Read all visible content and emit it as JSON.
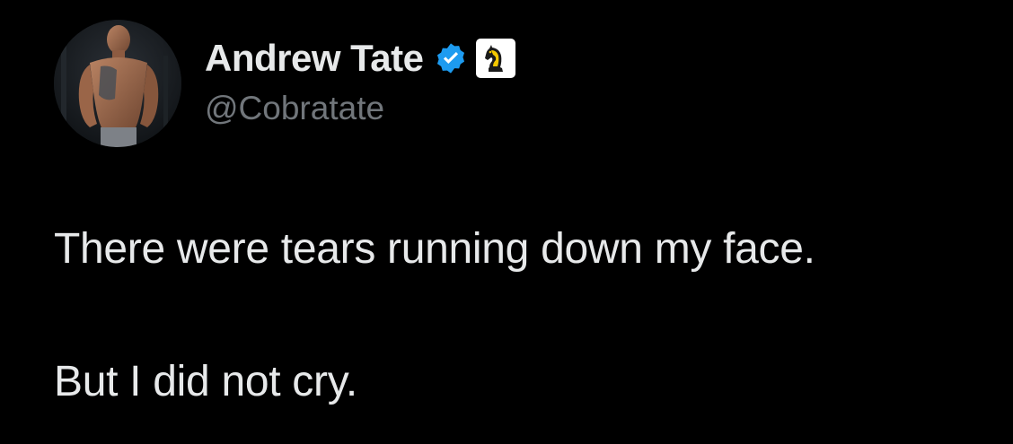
{
  "tweet": {
    "author": {
      "display_name": "Andrew Tate",
      "handle": "@Cobratate",
      "verified_icon": "verified-badge-icon",
      "affiliate_icon": "chess-knight-icon"
    },
    "text_lines": [
      "There were tears running down my face.",
      "But I did not cry."
    ]
  },
  "colors": {
    "background": "#000000",
    "primary_text": "#e7e9ea",
    "secondary_text": "#71767b",
    "verified_blue": "#1d9bf0",
    "affiliate_gold": "#f4c800"
  }
}
